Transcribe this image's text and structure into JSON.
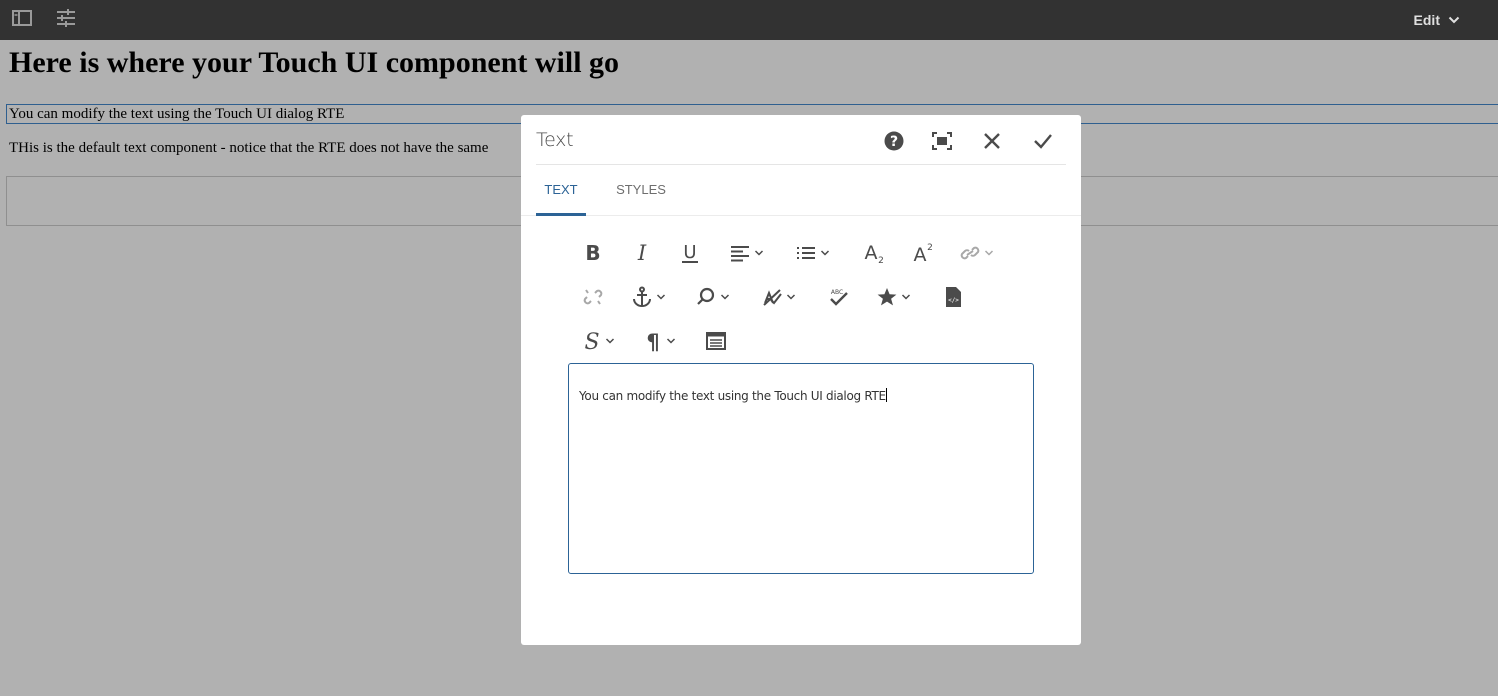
{
  "toolbar": {
    "side_panel_icon": "side-panel-icon",
    "properties_icon": "sliders-icon",
    "mode_label": "Edit"
  },
  "page": {
    "title": "Here is where your Touch UI component will go",
    "rte_paragraph": "You can modify the text using the Touch UI dialog RTE",
    "default_paragraph": "THis is the default text component - notice that the RTE does not have the same"
  },
  "dialog": {
    "title": "Text",
    "header_icons": [
      "help-icon",
      "fullscreen-icon",
      "close-icon",
      "checkmark-icon"
    ],
    "tabs": [
      {
        "label": "TEXT",
        "active": true
      },
      {
        "label": "STYLES",
        "active": false
      }
    ],
    "rte_toolbar": [
      "bold",
      "italic",
      "underline",
      "align",
      "list",
      "subscript",
      "superscript",
      "link",
      "unlink",
      "anchor",
      "find",
      "spellcheck-settings",
      "spellcheck",
      "special-chars",
      "source-edit",
      "styles",
      "paragraph-format",
      "table"
    ],
    "editor_value": "You can modify the text using the Touch UI dialog RTE",
    "accent": "#2c6396"
  }
}
